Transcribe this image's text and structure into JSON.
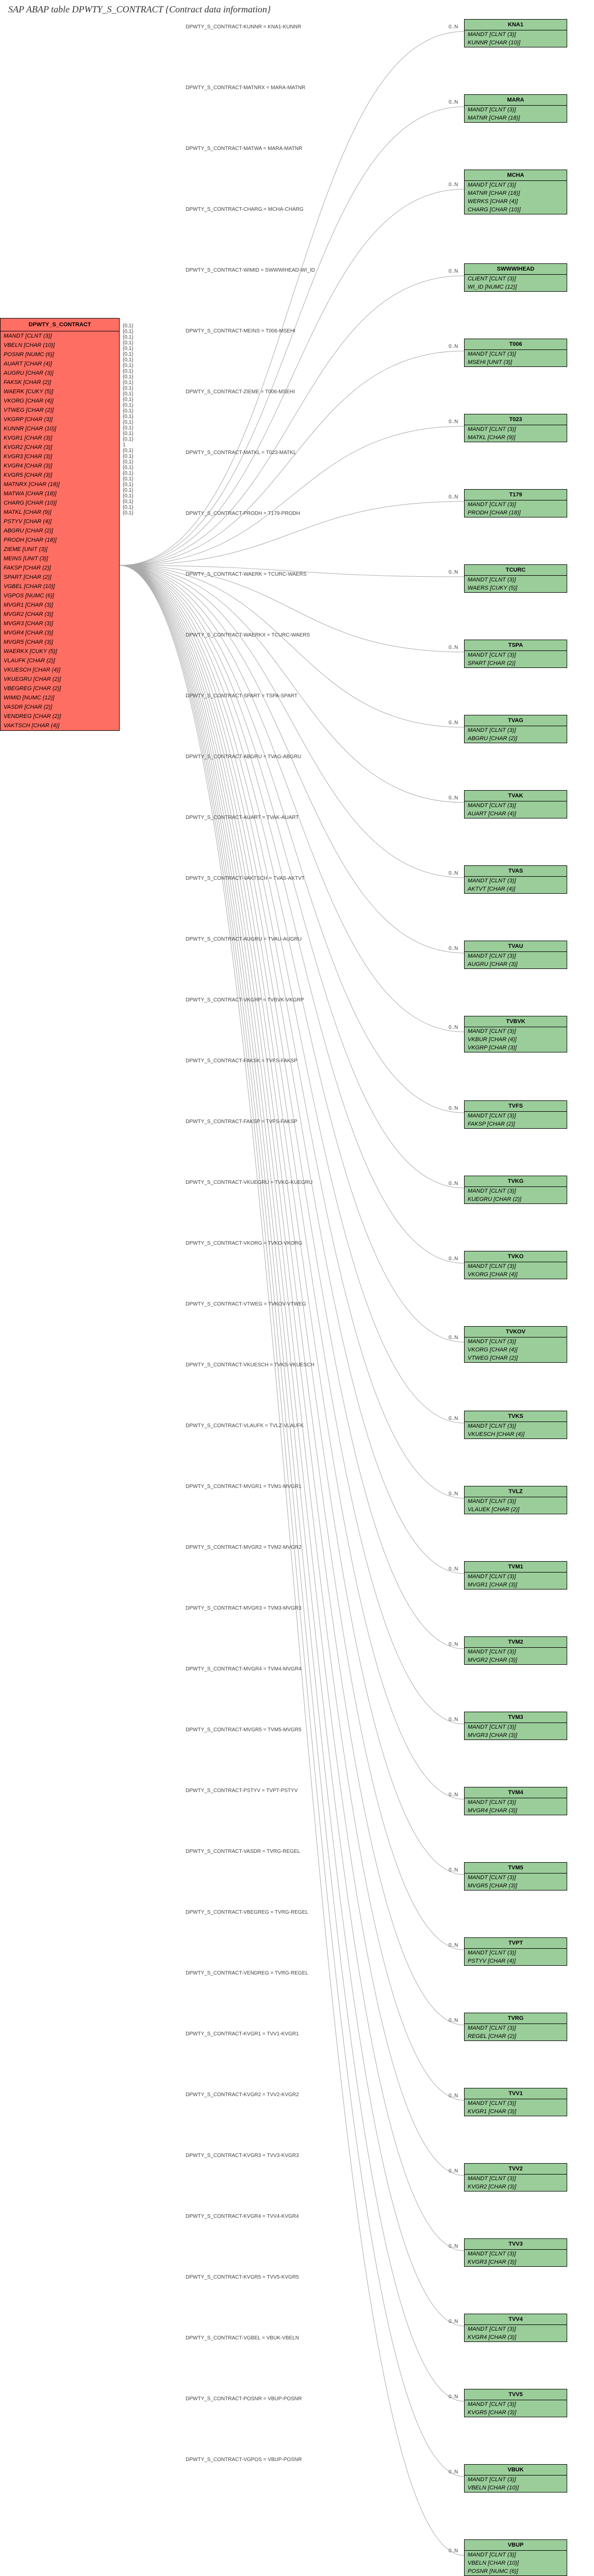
{
  "title": "SAP ABAP table DPWTY_S_CONTRACT {Contract data information}",
  "main": {
    "name": "DPWTY_S_CONTRACT",
    "fields": [
      "MANDT [CLNT (3)]",
      "VBELN [CHAR (10)]",
      "POSNR [NUMC (6)]",
      "AUART [CHAR (4)]",
      "AUGRU [CHAR (3)]",
      "FAKSK [CHAR (2)]",
      "WAERK [CUKY (5)]",
      "VKORG [CHAR (4)]",
      "VTWEG [CHAR (2)]",
      "VKGRP [CHAR (3)]",
      "KUNNR [CHAR (10)]",
      "KVGR1 [CHAR (3)]",
      "KVGR2 [CHAR (3)]",
      "KVGR3 [CHAR (3)]",
      "KVGR4 [CHAR (3)]",
      "KVGR5 [CHAR (3)]",
      "MATNRX [CHAR (18)]",
      "MATWA [CHAR (18)]",
      "CHARG [CHAR (10)]",
      "MATKL [CHAR (9)]",
      "PSTYV [CHAR (4)]",
      "ABGRU [CHAR (2)]",
      "PRODH [CHAR (18)]",
      "ZIEME [UNIT (3)]",
      "MEINS [UNIT (3)]",
      "FAKSP [CHAR (2)]",
      "SPART [CHAR (2)]",
      "VGBEL [CHAR (10)]",
      "VGPOS [NUMC (6)]",
      "MVGR1 [CHAR (3)]",
      "MVGR2 [CHAR (3)]",
      "MVGR3 [CHAR (3)]",
      "MVGR4 [CHAR (3)]",
      "MVGR5 [CHAR (3)]",
      "WAERKX [CUKY (5)]",
      "VLAUFK [CHAR (2)]",
      "VKUESCH [CHAR (4)]",
      "VKUEGRU [CHAR (2)]",
      "VBEGREG [CHAR (2)]",
      "WIMID [NUMC (12)]",
      "VASDR [CHAR (2)]",
      "VENDREG [CHAR (2)]",
      "VAKTSCH [CHAR (4)]"
    ]
  },
  "refs": [
    {
      "name": "KNA1",
      "fields": [
        "MANDT [CLNT (3)]",
        "KUNNR [CHAR (10)]"
      ],
      "label": "DPWTY_S_CONTRACT-KUNNR = KNA1-KUNNR",
      "card1": "{0,1}",
      "card2": "0..N"
    },
    {
      "name": "MARA",
      "fields": [
        "MANDT [CLNT (3)]",
        "MATNR [CHAR (18)]"
      ],
      "label": "DPWTY_S_CONTRACT-MATNRX = MARA-MATNR",
      "card1": "{0,1}",
      "card2": "0..N"
    },
    {
      "name": "MCHA",
      "fields": [
        "MANDT [CLNT (3)]",
        "MATNR [CHAR (18)]",
        "WERKS [CHAR (4)]",
        "CHARG [CHAR (10)]"
      ],
      "label": "DPWTY_S_CONTRACT-MATWA = MARA-MATNR",
      "card1": "{0,1}",
      "card2": "0..N"
    },
    {
      "name": "SWWWIHEAD",
      "fields": [
        "CLIENT [CLNT (3)]",
        "WI_ID [NUMC (12)]"
      ],
      "label": "DPWTY_S_CONTRACT-CHARG = MCHA-CHARG",
      "card1": "{0,1}",
      "card2": "0..N"
    },
    {
      "name": "T006",
      "fields": [
        "MANDT [CLNT (3)]",
        "MSEHI [UNIT (3)]"
      ],
      "label": "DPWTY_S_CONTRACT-WIMID = SWWWIHEAD-WI_ID",
      "card1": "{0,1}",
      "card2": "0..N"
    },
    {
      "name": "T023",
      "fields": [
        "MANDT [CLNT (3)]",
        "MATKL [CHAR (9)]"
      ],
      "label": "DPWTY_S_CONTRACT-MEINS = T006-MSEHI",
      "card1": "{0,1}",
      "card2": "0..N"
    },
    {
      "name": "T179",
      "fields": [
        "MANDT [CLNT (3)]",
        "PRODH [CHAR (18)]"
      ],
      "label": "DPWTY_S_CONTRACT-ZIEME = T006-MSEHI",
      "card1": "{0,1}",
      "card2": "0..N"
    },
    {
      "name": "TCURC",
      "fields": [
        "MANDT [CLNT (3)]",
        "WAERS [CUKY (5)]"
      ],
      "label": "DPWTY_S_CONTRACT-MATKL = T023-MATKL",
      "card1": "{0,1}",
      "card2": "0..N"
    },
    {
      "name": "TSPA",
      "fields": [
        "MANDT [CLNT (3)]",
        "SPART [CHAR (2)]"
      ],
      "label": "DPWTY_S_CONTRACT-PRODH = T179-PRODH",
      "card1": "{0,1}",
      "card2": "0..N"
    },
    {
      "name": "TVAG",
      "fields": [
        "MANDT [CLNT (3)]",
        "ABGRU [CHAR (2)]"
      ],
      "label": "DPWTY_S_CONTRACT-WAERK = TCURC-WAERS",
      "card1": "{0,1}",
      "card2": "0..N"
    },
    {
      "name": "TVAK",
      "fields": [
        "MANDT [CLNT (3)]",
        "AUART [CHAR (4)]"
      ],
      "label": "DPWTY_S_CONTRACT-WAERKX = TCURC-WAERS",
      "card1": "{0,1}",
      "card2": "0..N"
    },
    {
      "name": "TVAS",
      "fields": [
        "MANDT [CLNT (3)]",
        "AKTVT [CHAR (4)]"
      ],
      "label": "DPWTY_S_CONTRACT-SPART = TSPA-SPART",
      "card1": "{0,1}",
      "card2": "0..N"
    },
    {
      "name": "TVAU",
      "fields": [
        "MANDT [CLNT (3)]",
        "AUGRU [CHAR (3)]"
      ],
      "label": "DPWTY_S_CONTRACT-ABGRU = TVAG-ABGRU",
      "card1": "{0,1}",
      "card2": "0..N"
    },
    {
      "name": "TVBVK",
      "fields": [
        "MANDT [CLNT (3)]",
        "VKBUR [CHAR (4)]",
        "VKGRP [CHAR (3)]"
      ],
      "label": "DPWTY_S_CONTRACT-AUART = TVAK-AUART",
      "card1": "{0,1}",
      "card2": "0..N"
    },
    {
      "name": "TVFS",
      "fields": [
        "MANDT [CLNT (3)]",
        "FAKSP [CHAR (2)]"
      ],
      "label": "DPWTY_S_CONTRACT-VAKTSCH = TVAS-AKTVT",
      "card1": "{0,1}",
      "card2": "0..N"
    },
    {
      "name": "TVKG",
      "fields": [
        "MANDT [CLNT (3)]",
        "KUEGRU [CHAR (2)]"
      ],
      "label": "DPWTY_S_CONTRACT-AUGRU = TVAU-AUGRU",
      "card1": "{0,1}",
      "card2": "0..N"
    },
    {
      "name": "TVKO",
      "fields": [
        "MANDT [CLNT (3)]",
        "VKORG [CHAR (4)]"
      ],
      "label": "DPWTY_S_CONTRACT-VKGRP = TVBVK-VKGRP",
      "card1": "{0,1}",
      "card2": "0..N"
    },
    {
      "name": "TVKOV",
      "fields": [
        "MANDT [CLNT (3)]",
        "VKORG [CHAR (4)]",
        "VTWEG [CHAR (2)]"
      ],
      "label": "DPWTY_S_CONTRACT-FAKSK = TVFS-FAKSP",
      "card1": "{0,1}",
      "card2": "0..N"
    },
    {
      "name": "TVKS",
      "fields": [
        "MANDT [CLNT (3)]",
        "VKUESCH [CHAR (4)]"
      ],
      "label": "DPWTY_S_CONTRACT-FAKSP = TVFS-FAKSP",
      "card1": "{0,1}",
      "card2": "0..N"
    },
    {
      "name": "TVLZ",
      "fields": [
        "MANDT [CLNT (3)]",
        "VLAUEK [CHAR (2)]"
      ],
      "label": "DPWTY_S_CONTRACT-VKUEGRU = TVKG-KUEGRU",
      "card1": "{0,1}",
      "card2": "0..N"
    },
    {
      "name": "TVM1",
      "fields": [
        "MANDT [CLNT (3)]",
        "MVGR1 [CHAR (3)]"
      ],
      "label": "DPWTY_S_CONTRACT-VKORG = TVKO-VKORG",
      "card1": "{0,1}",
      "card2": "0..N"
    },
    {
      "name": "TVM2",
      "fields": [
        "MANDT [CLNT (3)]",
        "MVGR2 [CHAR (3)]"
      ],
      "label": "DPWTY_S_CONTRACT-VTWEG = TVKOV-VTWEG",
      "card1": "1",
      "card2": "0..N"
    },
    {
      "name": "TVM3",
      "fields": [
        "MANDT [CLNT (3)]",
        "MVGR3 [CHAR (3)]"
      ],
      "label": "DPWTY_S_CONTRACT-VKUESCH = TVKS-VKUESCH",
      "card1": "{0,1}",
      "card2": "0..N"
    },
    {
      "name": "TVM4",
      "fields": [
        "MANDT [CLNT (3)]",
        "MVGR4 [CHAR (3)]"
      ],
      "label": "DPWTY_S_CONTRACT-VLAUFK = TVLZ-VLAUFK",
      "card1": "{0,1}",
      "card2": "0..N"
    },
    {
      "name": "TVM5",
      "fields": [
        "MANDT [CLNT (3)]",
        "MVGR5 [CHAR (3)]"
      ],
      "label": "DPWTY_S_CONTRACT-MVGR1 = TVM1-MVGR1",
      "card1": "{0,1}",
      "card2": "0..N"
    },
    {
      "name": "TVPT",
      "fields": [
        "MANDT [CLNT (3)]",
        "PSTYV [CHAR (4)]"
      ],
      "label": "DPWTY_S_CONTRACT-MVGR2 = TVM2-MVGR2",
      "card1": "{0,1}",
      "card2": "0..N"
    },
    {
      "name": "TVRG",
      "fields": [
        "MANDT [CLNT (3)]",
        "REGEL [CHAR (2)]"
      ],
      "label": "DPWTY_S_CONTRACT-MVGR3 = TVM3-MVGR3",
      "card1": "{0,1}",
      "card2": "0..N"
    },
    {
      "name": "TVV1",
      "fields": [
        "MANDT [CLNT (3)]",
        "KVGR1 [CHAR (3)]"
      ],
      "label": "DPWTY_S_CONTRACT-MVGR4 = TVM4-MVGR4",
      "card1": "{0,1}",
      "card2": "0..N"
    },
    {
      "name": "TVV2",
      "fields": [
        "MANDT [CLNT (3)]",
        "KVGR2 [CHAR (3)]"
      ],
      "label": "DPWTY_S_CONTRACT-MVGR5 = TVM5-MVGR5",
      "card1": "{0,1}",
      "card2": "0..N"
    },
    {
      "name": "TVV3",
      "fields": [
        "MANDT [CLNT (3)]",
        "KVGR3 [CHAR (3)]"
      ],
      "label": "DPWTY_S_CONTRACT-PSTYV = TVPT-PSTYV",
      "card1": "{0,1}",
      "card2": "0..N"
    },
    {
      "name": "TVV4",
      "fields": [
        "MANDT [CLNT (3)]",
        "KVGR4 [CHAR (3)]"
      ],
      "label": "DPWTY_S_CONTRACT-VASDR = TVRG-REGEL",
      "card1": "{0,1}",
      "card2": "0..N"
    },
    {
      "name": "TVV5",
      "fields": [
        "MANDT [CLNT (3)]",
        "KVGR5 [CHAR (3)]"
      ],
      "label": "DPWTY_S_CONTRACT-VBEGREG = TVRG-REGEL",
      "card1": "{0,1}",
      "card2": "0..N"
    },
    {
      "name": "VBUK",
      "fields": [
        "MANDT [CLNT (3)]",
        "VBELN [CHAR (10)]"
      ],
      "label": "DPWTY_S_CONTRACT-VENDREG = TVRG-REGEL",
      "card1": "{0,1}",
      "card2": "0..N"
    },
    {
      "name": "VBUP",
      "fields": [
        "MANDT [CLNT (3)]",
        "VBELN [CHAR (10)]",
        "POSNR [NUMC (6)]"
      ],
      "label": "DPWTY_S_CONTRACT-KVGR1 = TVV1-KVGR1",
      "card1": "{0,1}",
      "card2": "0..N"
    }
  ],
  "extra_labels": [
    "DPWTY_S_CONTRACT-KVGR2 = TVV2-KVGR2",
    "DPWTY_S_CONTRACT-KVGR3 = TVV3-KVGR3",
    "DPWTY_S_CONTRACT-KVGR4 = TVV4-KVGR4",
    "DPWTY_S_CONTRACT-KVGR5 = TVV5-KVGR5",
    "DPWTY_S_CONTRACT-VGBEL = VBUK-VBELN",
    "DPWTY_S_CONTRACT-POSNR = VBUP-POSNR",
    "DPWTY_S_CONTRACT-VGPOS = VBUP-POSNR"
  ],
  "colors": {
    "main": "#ff6e63",
    "ref": "#9acd9a",
    "line": "#aaaaaa"
  }
}
